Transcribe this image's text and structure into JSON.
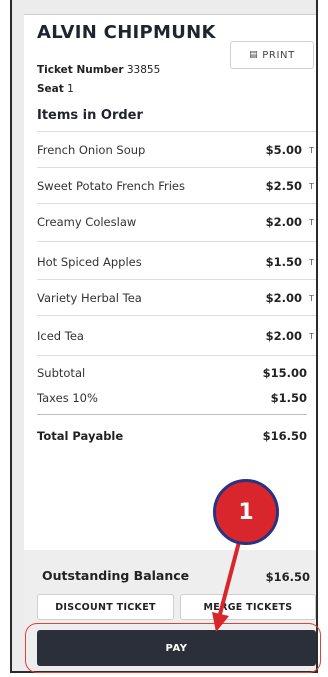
{
  "order_panel": {
    "customer_name": "ALVIN CHIPMUNK",
    "print_label": "PRINT",
    "ticket_number_label": "Ticket Number",
    "ticket_number": "33855",
    "seat_label": "Seat",
    "seat": "1",
    "items_title": "Items in Order",
    "items": [
      {
        "name": "French Onion Soup",
        "price": "$5.00",
        "tax": "T"
      },
      {
        "name": "Sweet Potato French Fries",
        "price": "$2.50",
        "tax": "T"
      },
      {
        "name": "Creamy Coleslaw",
        "price": "$2.00",
        "tax": "T"
      },
      {
        "name": "Hot Spiced Apples",
        "price": "$1.50",
        "tax": "T"
      },
      {
        "name": "Variety Herbal Tea",
        "price": "$2.00",
        "tax": "T"
      },
      {
        "name": "Iced Tea",
        "price": "$2.00",
        "tax": "T"
      }
    ],
    "subtotal_label": "Subtotal",
    "subtotal": "$15.00",
    "taxes_label": "Taxes 10%",
    "taxes": "$1.50",
    "total_label": "Total Payable",
    "total": "$16.50",
    "outstanding_label": "Outstanding Balance",
    "outstanding": "$16.50",
    "discount_label": "DISCOUNT TICKET",
    "merge_label": "MERGE TICKETS",
    "pay_label": "PAY"
  },
  "annotation": {
    "step_number": "1",
    "color": "#d9262c"
  }
}
